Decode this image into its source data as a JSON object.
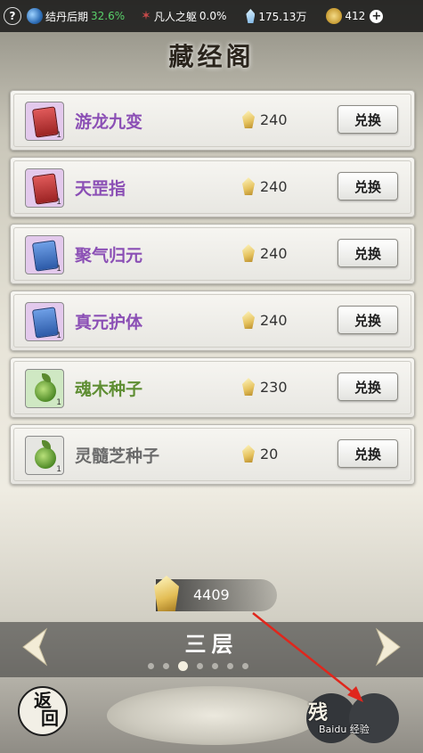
{
  "topbar": {
    "help": "?",
    "realm_label": "结丹后期",
    "realm_pct": "32.6%",
    "body_label": "凡人之躯",
    "body_pct": "0.0%",
    "spirit_stones": "175.13万",
    "coins": "412",
    "plus": "+"
  },
  "title": "藏经阁",
  "items": [
    {
      "name": "游龙九变",
      "count": "1",
      "price": "240",
      "button": "兑换",
      "name_color": "#8b4fb5",
      "icon_bg": "#e3c9ec",
      "icon_kind": "red-book"
    },
    {
      "name": "天罡指",
      "count": "1",
      "price": "240",
      "button": "兑换",
      "name_color": "#8b4fb5",
      "icon_bg": "#e3c9ec",
      "icon_kind": "red-book"
    },
    {
      "name": "聚气归元",
      "count": "1",
      "price": "240",
      "button": "兑换",
      "name_color": "#8b4fb5",
      "icon_bg": "#e3c9ec",
      "icon_kind": "blue-book"
    },
    {
      "name": "真元护体",
      "count": "1",
      "price": "240",
      "button": "兑换",
      "name_color": "#8b4fb5",
      "icon_bg": "#e3c9ec",
      "icon_kind": "blue-book"
    },
    {
      "name": "魂木种子",
      "count": "1",
      "price": "230",
      "button": "兑换",
      "name_color": "#5f8e33",
      "icon_bg": "#cfe8c3",
      "icon_kind": "green-seed"
    },
    {
      "name": "灵髓芝种子",
      "count": "1",
      "price": "20",
      "button": "兑换",
      "name_color": "#6b6b6b",
      "icon_bg": "#e6e6e2",
      "icon_kind": "green-seed"
    }
  ],
  "currency": "4409",
  "floor": "三层",
  "page_dots": {
    "total": 7,
    "active": 3
  },
  "back_button": [
    "返",
    "回"
  ],
  "residual_button": "残",
  "watermark": "Baidu 经验"
}
